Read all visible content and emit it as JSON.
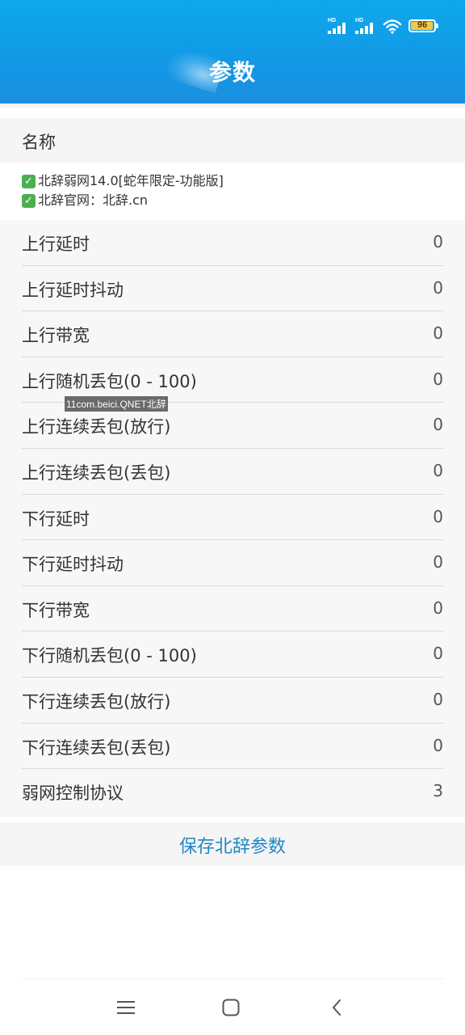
{
  "status_bar": {
    "signal_1_label": "HD",
    "signal_2_label": "HD",
    "battery_level": 96,
    "battery_text": "96",
    "colors": {
      "battery_fill": "#f3c84b"
    }
  },
  "header": {
    "title": "参数",
    "colors": {
      "background": "#1296e4",
      "title": "#ffffff"
    }
  },
  "name_section": {
    "label": "名称",
    "lines": [
      "北辞弱网14.0[蛇年限定-功能版]",
      "北辞官网：北辞.cn"
    ],
    "line_icon": "check-mark-icon"
  },
  "params": [
    {
      "label": "上行延时",
      "value": "0"
    },
    {
      "label": "上行延时抖动",
      "value": "0"
    },
    {
      "label": "上行带宽",
      "value": "0"
    },
    {
      "label": "上行随机丢包(0 - 100)",
      "value": "0"
    },
    {
      "label": "上行连续丢包(放行)",
      "value": "0"
    },
    {
      "label": "上行连续丢包(丢包)",
      "value": "0"
    },
    {
      "label": "下行延时",
      "value": "0"
    },
    {
      "label": "下行延时抖动",
      "value": "0"
    },
    {
      "label": "下行带宽",
      "value": "0"
    },
    {
      "label": "下行随机丢包(0 - 100)",
      "value": "0"
    },
    {
      "label": "下行连续丢包(放行)",
      "value": "0"
    },
    {
      "label": "下行连续丢包(丢包)",
      "value": "0"
    },
    {
      "label": "弱网控制协议",
      "value": "3"
    }
  ],
  "watermark": "11com.beici.QNET北辞",
  "save_button": {
    "label": "保存北辞参数",
    "colors": {
      "text": "#1e88c8"
    }
  },
  "nav_bar": {
    "icons": [
      "menu-icon",
      "home-icon",
      "back-icon"
    ]
  }
}
